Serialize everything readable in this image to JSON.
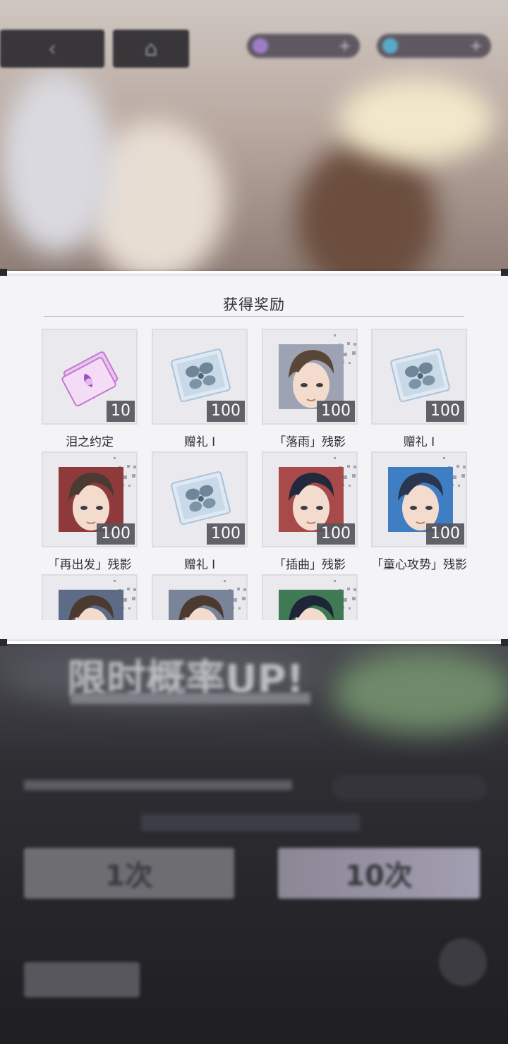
{
  "modal": {
    "title": "获得奖励"
  },
  "rewards": [
    {
      "name": "泪之约定",
      "count": "10",
      "kind": "ticket-icon"
    },
    {
      "name": "赠礼 I",
      "count": "100",
      "kind": "gift-card-icon"
    },
    {
      "name": "「落雨」残影",
      "count": "100",
      "kind": "portrait",
      "hair": "#5a4638",
      "bg": "#9ea3b4"
    },
    {
      "name": "赠礼 I",
      "count": "100",
      "kind": "gift-card-icon"
    },
    {
      "name": "「再出发」残影",
      "count": "100",
      "kind": "portrait",
      "hair": "#4a3a32",
      "bg": "#8f3a3a"
    },
    {
      "name": "赠礼 I",
      "count": "100",
      "kind": "gift-card-icon"
    },
    {
      "name": "「插曲」残影",
      "count": "100",
      "kind": "portrait",
      "hair": "#22293d",
      "bg": "#a84a4a"
    },
    {
      "name": "「童心攻势」残影",
      "count": "100",
      "kind": "portrait",
      "hair": "#2a3550",
      "bg": "#3f7ec2"
    },
    {
      "name": "",
      "count": "",
      "kind": "portrait",
      "hair": "#4c3a30",
      "bg": "#5d6b86"
    },
    {
      "name": "",
      "count": "",
      "kind": "portrait",
      "hair": "#4c3a30",
      "bg": "#7a8499"
    },
    {
      "name": "",
      "count": "",
      "kind": "portrait",
      "hair": "#1e2538",
      "bg": "#3f7a55"
    }
  ],
  "background": {
    "back_icon": "chevron-left-icon",
    "home_icon": "home-icon",
    "banner_text": "限时概率UP!",
    "single_draw": "1次",
    "ten_draw": "10次"
  },
  "colors": {
    "modal_bg": "#f4f4f6",
    "count_badge": "#55555c",
    "label_text": "#2d2d33"
  }
}
